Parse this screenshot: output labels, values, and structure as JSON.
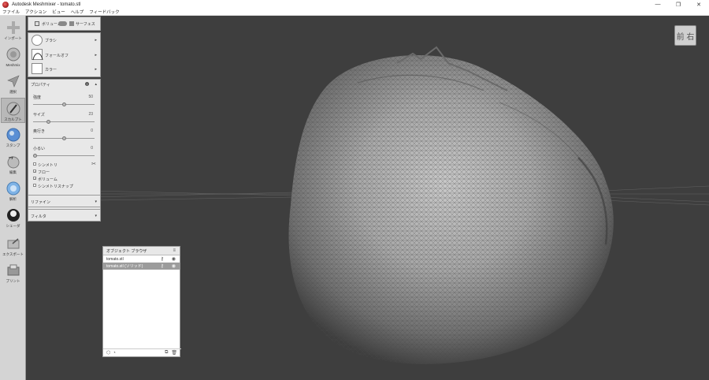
{
  "window": {
    "title": "Autodesk Meshmixer - tomato.stl",
    "minimize": "—",
    "restore": "❐",
    "close": "✕"
  },
  "menu": [
    "ファイル",
    "アクション",
    "ビュー",
    "ヘルプ",
    "フィードバック"
  ],
  "toolbar": {
    "items": [
      {
        "label": "インポート",
        "icon": "plus-icon"
      },
      {
        "label": "Meshmix",
        "icon": "meshmix-icon"
      },
      {
        "label": "選択",
        "icon": "select-arrow-icon"
      },
      {
        "label": "スカルプト",
        "icon": "brush-icon"
      },
      {
        "label": "スタンプ",
        "icon": "stamp-icon"
      },
      {
        "label": "編集",
        "icon": "edit-icon"
      },
      {
        "label": "解析",
        "icon": "analysis-icon"
      },
      {
        "label": "シェーダ",
        "icon": "shader-icon"
      },
      {
        "label": "エクスポート",
        "icon": "export-icon"
      },
      {
        "label": "プリント",
        "icon": "print-icon"
      }
    ],
    "active_index": 3
  },
  "sculpt": {
    "mode_volume": "ボリューム",
    "mode_surface": "サーフェス",
    "brush_label": "ブラシ",
    "falloff_label": "フォールオフ",
    "color_label": "カラー",
    "properties_label": "プロパティ",
    "strength_label": "強度",
    "strength_value": "50",
    "size_label": "サイズ",
    "size_value": "23",
    "depth_label": "奥行き",
    "depth_value": "0",
    "lazy_label": "小るい",
    "lazy_value": "0",
    "symmetry_label": "シンメトリ",
    "flow_label": "フロー",
    "volume_label": "ボリューム",
    "symmetry_snap_label": "シンメトリスナップ",
    "refine_label": "リファイン",
    "filter_label": "フィルタ",
    "slider_fraction": {
      "strength": 0.5,
      "size": 0.23,
      "depth": 0.5,
      "lazy": 0.0
    }
  },
  "viewport": {
    "navcube_label": "前 右"
  },
  "object_browser": {
    "title": "オブジェクト ブラウザ",
    "items": [
      {
        "name": "tomato.stl",
        "selected": false
      },
      {
        "name": "tomato.stl (ソリッド)",
        "selected": true
      }
    ]
  }
}
